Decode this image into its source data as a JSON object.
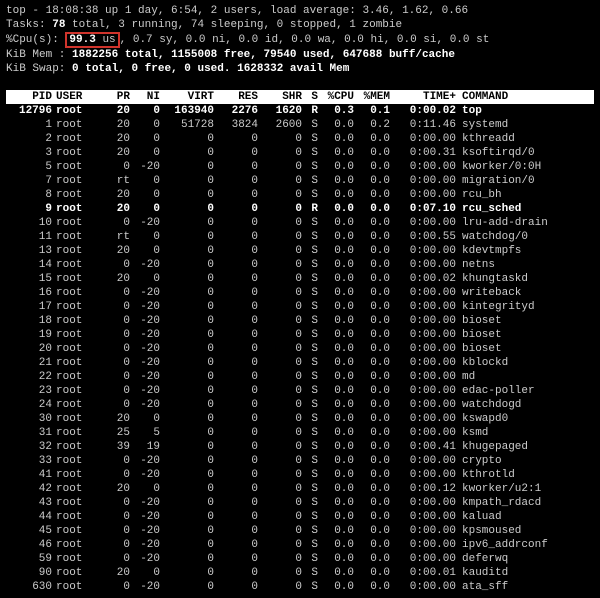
{
  "summary": {
    "line1_prefix": "top - 18:08:38 up 1 day,  6:54,  2 users,  load average: 3.46, 1.62, 0.66",
    "tasks": {
      "label": "Tasks:",
      "total": "78",
      "total_suffix": "total,",
      "running": "3 running,  74 sleeping,   0 stopped,   1 zombie"
    },
    "cpu": {
      "label": "%Cpu(s):",
      "us": "99.3",
      "us_suffix": "us",
      "rest": " 0.7 sy,  0.0 ni,  0.0 id,  0.0 wa,  0.0 hi,  0.0 si,  0.0 st"
    },
    "mem": {
      "label": "KiB Mem :",
      "total": "1882256 total,",
      "free": "1155008 free,",
      "used": "79540 used,",
      "buff": "647688 buff/cache"
    },
    "swap": {
      "label": "KiB Swap:",
      "total": "0 total,",
      "free": "0 free,",
      "used": "0 used.",
      "avail": "1628332 avail Mem"
    }
  },
  "headers": {
    "pid": "PID",
    "user": "USER",
    "pr": "PR",
    "ni": "NI",
    "virt": "VIRT",
    "res": "RES",
    "shr": "SHR",
    "s": "S",
    "cpu": "%CPU",
    "mem": "%MEM",
    "time": "TIME+",
    "cmd": "COMMAND"
  },
  "rows": [
    {
      "pid": "12796",
      "user": "root",
      "pr": "20",
      "ni": "0",
      "virt": "163940",
      "res": "2276",
      "shr": "1620",
      "s": "R",
      "cpu": "0.3",
      "mem": "0.1",
      "time": "0:00.02",
      "cmd": "top",
      "bold": true
    },
    {
      "pid": "1",
      "user": "root",
      "pr": "20",
      "ni": "0",
      "virt": "51728",
      "res": "3824",
      "shr": "2600",
      "s": "S",
      "cpu": "0.0",
      "mem": "0.2",
      "time": "0:11.46",
      "cmd": "systemd"
    },
    {
      "pid": "2",
      "user": "root",
      "pr": "20",
      "ni": "0",
      "virt": "0",
      "res": "0",
      "shr": "0",
      "s": "S",
      "cpu": "0.0",
      "mem": "0.0",
      "time": "0:00.00",
      "cmd": "kthreadd"
    },
    {
      "pid": "3",
      "user": "root",
      "pr": "20",
      "ni": "0",
      "virt": "0",
      "res": "0",
      "shr": "0",
      "s": "S",
      "cpu": "0.0",
      "mem": "0.0",
      "time": "0:00.31",
      "cmd": "ksoftirqd/0"
    },
    {
      "pid": "5",
      "user": "root",
      "pr": "0",
      "ni": "-20",
      "virt": "0",
      "res": "0",
      "shr": "0",
      "s": "S",
      "cpu": "0.0",
      "mem": "0.0",
      "time": "0:00.00",
      "cmd": "kworker/0:0H"
    },
    {
      "pid": "7",
      "user": "root",
      "pr": "rt",
      "ni": "0",
      "virt": "0",
      "res": "0",
      "shr": "0",
      "s": "S",
      "cpu": "0.0",
      "mem": "0.0",
      "time": "0:00.00",
      "cmd": "migration/0"
    },
    {
      "pid": "8",
      "user": "root",
      "pr": "20",
      "ni": "0",
      "virt": "0",
      "res": "0",
      "shr": "0",
      "s": "S",
      "cpu": "0.0",
      "mem": "0.0",
      "time": "0:00.00",
      "cmd": "rcu_bh"
    },
    {
      "pid": "9",
      "user": "root",
      "pr": "20",
      "ni": "0",
      "virt": "0",
      "res": "0",
      "shr": "0",
      "s": "R",
      "cpu": "0.0",
      "mem": "0.0",
      "time": "0:07.10",
      "cmd": "rcu_sched",
      "bold": true
    },
    {
      "pid": "10",
      "user": "root",
      "pr": "0",
      "ni": "-20",
      "virt": "0",
      "res": "0",
      "shr": "0",
      "s": "S",
      "cpu": "0.0",
      "mem": "0.0",
      "time": "0:00.00",
      "cmd": "lru-add-drain"
    },
    {
      "pid": "11",
      "user": "root",
      "pr": "rt",
      "ni": "0",
      "virt": "0",
      "res": "0",
      "shr": "0",
      "s": "S",
      "cpu": "0.0",
      "mem": "0.0",
      "time": "0:00.55",
      "cmd": "watchdog/0"
    },
    {
      "pid": "13",
      "user": "root",
      "pr": "20",
      "ni": "0",
      "virt": "0",
      "res": "0",
      "shr": "0",
      "s": "S",
      "cpu": "0.0",
      "mem": "0.0",
      "time": "0:00.00",
      "cmd": "kdevtmpfs"
    },
    {
      "pid": "14",
      "user": "root",
      "pr": "0",
      "ni": "-20",
      "virt": "0",
      "res": "0",
      "shr": "0",
      "s": "S",
      "cpu": "0.0",
      "mem": "0.0",
      "time": "0:00.00",
      "cmd": "netns"
    },
    {
      "pid": "15",
      "user": "root",
      "pr": "20",
      "ni": "0",
      "virt": "0",
      "res": "0",
      "shr": "0",
      "s": "S",
      "cpu": "0.0",
      "mem": "0.0",
      "time": "0:00.02",
      "cmd": "khungtaskd"
    },
    {
      "pid": "16",
      "user": "root",
      "pr": "0",
      "ni": "-20",
      "virt": "0",
      "res": "0",
      "shr": "0",
      "s": "S",
      "cpu": "0.0",
      "mem": "0.0",
      "time": "0:00.00",
      "cmd": "writeback"
    },
    {
      "pid": "17",
      "user": "root",
      "pr": "0",
      "ni": "-20",
      "virt": "0",
      "res": "0",
      "shr": "0",
      "s": "S",
      "cpu": "0.0",
      "mem": "0.0",
      "time": "0:00.00",
      "cmd": "kintegrityd"
    },
    {
      "pid": "18",
      "user": "root",
      "pr": "0",
      "ni": "-20",
      "virt": "0",
      "res": "0",
      "shr": "0",
      "s": "S",
      "cpu": "0.0",
      "mem": "0.0",
      "time": "0:00.00",
      "cmd": "bioset"
    },
    {
      "pid": "19",
      "user": "root",
      "pr": "0",
      "ni": "-20",
      "virt": "0",
      "res": "0",
      "shr": "0",
      "s": "S",
      "cpu": "0.0",
      "mem": "0.0",
      "time": "0:00.00",
      "cmd": "bioset"
    },
    {
      "pid": "20",
      "user": "root",
      "pr": "0",
      "ni": "-20",
      "virt": "0",
      "res": "0",
      "shr": "0",
      "s": "S",
      "cpu": "0.0",
      "mem": "0.0",
      "time": "0:00.00",
      "cmd": "bioset"
    },
    {
      "pid": "21",
      "user": "root",
      "pr": "0",
      "ni": "-20",
      "virt": "0",
      "res": "0",
      "shr": "0",
      "s": "S",
      "cpu": "0.0",
      "mem": "0.0",
      "time": "0:00.00",
      "cmd": "kblockd"
    },
    {
      "pid": "22",
      "user": "root",
      "pr": "0",
      "ni": "-20",
      "virt": "0",
      "res": "0",
      "shr": "0",
      "s": "S",
      "cpu": "0.0",
      "mem": "0.0",
      "time": "0:00.00",
      "cmd": "md"
    },
    {
      "pid": "23",
      "user": "root",
      "pr": "0",
      "ni": "-20",
      "virt": "0",
      "res": "0",
      "shr": "0",
      "s": "S",
      "cpu": "0.0",
      "mem": "0.0",
      "time": "0:00.00",
      "cmd": "edac-poller"
    },
    {
      "pid": "24",
      "user": "root",
      "pr": "0",
      "ni": "-20",
      "virt": "0",
      "res": "0",
      "shr": "0",
      "s": "S",
      "cpu": "0.0",
      "mem": "0.0",
      "time": "0:00.00",
      "cmd": "watchdogd"
    },
    {
      "pid": "30",
      "user": "root",
      "pr": "20",
      "ni": "0",
      "virt": "0",
      "res": "0",
      "shr": "0",
      "s": "S",
      "cpu": "0.0",
      "mem": "0.0",
      "time": "0:00.00",
      "cmd": "kswapd0"
    },
    {
      "pid": "31",
      "user": "root",
      "pr": "25",
      "ni": "5",
      "virt": "0",
      "res": "0",
      "shr": "0",
      "s": "S",
      "cpu": "0.0",
      "mem": "0.0",
      "time": "0:00.00",
      "cmd": "ksmd"
    },
    {
      "pid": "32",
      "user": "root",
      "pr": "39",
      "ni": "19",
      "virt": "0",
      "res": "0",
      "shr": "0",
      "s": "S",
      "cpu": "0.0",
      "mem": "0.0",
      "time": "0:00.41",
      "cmd": "khugepaged"
    },
    {
      "pid": "33",
      "user": "root",
      "pr": "0",
      "ni": "-20",
      "virt": "0",
      "res": "0",
      "shr": "0",
      "s": "S",
      "cpu": "0.0",
      "mem": "0.0",
      "time": "0:00.00",
      "cmd": "crypto"
    },
    {
      "pid": "41",
      "user": "root",
      "pr": "0",
      "ni": "-20",
      "virt": "0",
      "res": "0",
      "shr": "0",
      "s": "S",
      "cpu": "0.0",
      "mem": "0.0",
      "time": "0:00.00",
      "cmd": "kthrotld"
    },
    {
      "pid": "42",
      "user": "root",
      "pr": "20",
      "ni": "0",
      "virt": "0",
      "res": "0",
      "shr": "0",
      "s": "S",
      "cpu": "0.0",
      "mem": "0.0",
      "time": "0:00.12",
      "cmd": "kworker/u2:1"
    },
    {
      "pid": "43",
      "user": "root",
      "pr": "0",
      "ni": "-20",
      "virt": "0",
      "res": "0",
      "shr": "0",
      "s": "S",
      "cpu": "0.0",
      "mem": "0.0",
      "time": "0:00.00",
      "cmd": "kmpath_rdacd"
    },
    {
      "pid": "44",
      "user": "root",
      "pr": "0",
      "ni": "-20",
      "virt": "0",
      "res": "0",
      "shr": "0",
      "s": "S",
      "cpu": "0.0",
      "mem": "0.0",
      "time": "0:00.00",
      "cmd": "kaluad"
    },
    {
      "pid": "45",
      "user": "root",
      "pr": "0",
      "ni": "-20",
      "virt": "0",
      "res": "0",
      "shr": "0",
      "s": "S",
      "cpu": "0.0",
      "mem": "0.0",
      "time": "0:00.00",
      "cmd": "kpsmoused"
    },
    {
      "pid": "46",
      "user": "root",
      "pr": "0",
      "ni": "-20",
      "virt": "0",
      "res": "0",
      "shr": "0",
      "s": "S",
      "cpu": "0.0",
      "mem": "0.0",
      "time": "0:00.00",
      "cmd": "ipv6_addrconf"
    },
    {
      "pid": "59",
      "user": "root",
      "pr": "0",
      "ni": "-20",
      "virt": "0",
      "res": "0",
      "shr": "0",
      "s": "S",
      "cpu": "0.0",
      "mem": "0.0",
      "time": "0:00.00",
      "cmd": "deferwq"
    },
    {
      "pid": "90",
      "user": "root",
      "pr": "20",
      "ni": "0",
      "virt": "0",
      "res": "0",
      "shr": "0",
      "s": "S",
      "cpu": "0.0",
      "mem": "0.0",
      "time": "0:00.01",
      "cmd": "kauditd"
    },
    {
      "pid": "630",
      "user": "root",
      "pr": "0",
      "ni": "-20",
      "virt": "0",
      "res": "0",
      "shr": "0",
      "s": "S",
      "cpu": "0.0",
      "mem": "0.0",
      "time": "0:00.00",
      "cmd": "ata_sff"
    }
  ]
}
